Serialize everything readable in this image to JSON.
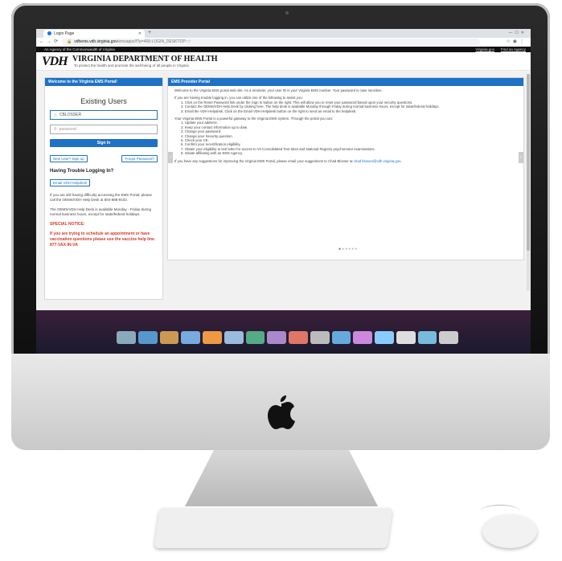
{
  "browser": {
    "tab_title": "Login Page",
    "new_tab": "+",
    "url_host": "vdhems.vdh.virginia.gov",
    "url_path": "/emsapps/f?p=400:LOGIN_DESKTOP:::::"
  },
  "agency_bar": {
    "left": "An Agency of the Commonwealth of Virginia",
    "links": [
      "Virginia.gov",
      "Find an Agency"
    ]
  },
  "header": {
    "logo": "VDH",
    "name": "VIRGINIA DEPARTMENT OF HEALTH",
    "tagline": "To protect the health and promote the well-being of all people in Virginia"
  },
  "left_panel": {
    "title": "Welcome to the Virginia EMS Portal!",
    "heading": "Existing Users",
    "username_value": "CBLOSSER",
    "password_placeholder": "password",
    "signin_label": "Sign In",
    "new_user_label": "New User? Sign up",
    "forgot_label": "Forgot Password?",
    "trouble_heading": "Having Trouble Logging In?",
    "email_helpdesk_label": "Email VDH Helpdesk",
    "help_text_1": "If you are still having difficulty accessing the EMS Portal, please call the OEMS/VDH Help Desk at 804-888-9102.",
    "help_text_2": "The OEMS/VDH Help Desk is available Monday - Friday during normal business hours, except for state/federal holidays.",
    "special_label": "SPECIAL NOTICE:",
    "special_text": "If you are trying to schedule an appointment or have vaccination questions please use the vaccine help line. 877-VAX-IN-VA"
  },
  "right_panel": {
    "title": "EMS Provider Portal",
    "intro": "Welcome to the Virginia EMS portal web site. As a reminder, your user ID is your Virginia EMS number. Your password is case sensitive.",
    "trouble_intro": "If you are having trouble logging in, you can utilize one of the following to assist you:",
    "trouble_steps": [
      "1. Click on the Reset Password link under the Sign In button on the right. This will allow you to reset your password based upon your security questions.",
      "2. Contact the OEMS/VDH Help Desk by clicking here. The help desk is available Monday through Friday during normal business hours, except for state/federal holidays.",
      "3. Email the VDH Helpdesk. Click on the Email VDH Helpdesk button on the right to send an email to the helpdesk."
    ],
    "gateway_intro": "Your Virginia EMS Portal is a powerful gateway to the Virginia EMS system. Through the portal you can:",
    "gateway_steps": [
      "1. Update your address.",
      "2. Keep your contact information up to date.",
      "3. Change your password.",
      "4. Change your Security question.",
      "5. Check your CE.",
      "6. Confirm your recertification eligibility.",
      "7. Obtain your eligibility to test letter for access to VA Consolidated Test Sites and National Registry psychomotor examinations.",
      "8. Initiate affiliating with an EMS Agency."
    ],
    "suggestion_text": "If you have any suggestions for improving the Virginia EMS Portal, please email your suggestions to Chad Blosser at",
    "suggestion_email": "chad.blosser@vdh.virginia.gov",
    "suggestion_end": "."
  },
  "carousel": {
    "dots": 6,
    "active_index": 0
  },
  "colors": {
    "accent": "#1e72c4",
    "notice": "#d23a2a",
    "agency_bar": "#111111"
  }
}
